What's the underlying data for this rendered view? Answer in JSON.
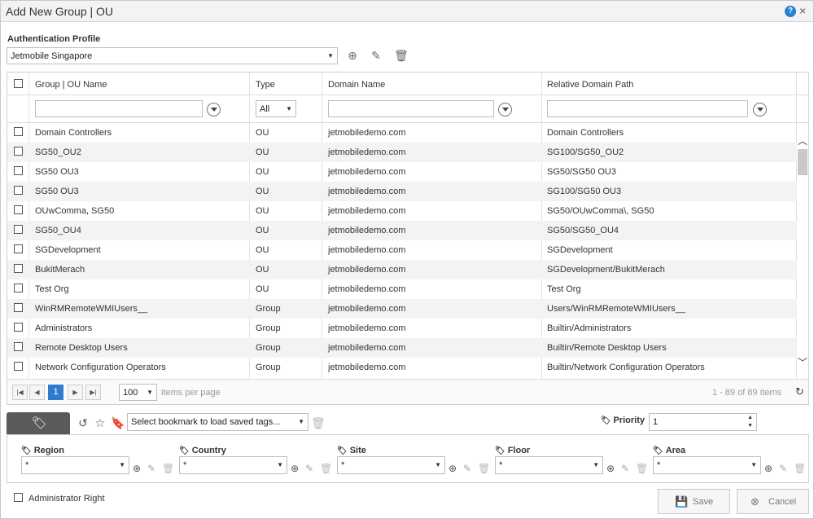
{
  "window": {
    "title": "Add New Group | OU",
    "help_icon": "?",
    "close_icon": "×"
  },
  "auth_profile": {
    "label": "Authentication Profile",
    "value": "Jetmobile Singapore"
  },
  "grid": {
    "headers": {
      "name": "Group | OU Name",
      "type": "Type",
      "domain": "Domain Name",
      "path": "Relative Domain Path"
    },
    "type_filter": "All",
    "rows": [
      {
        "name": "Domain Controllers",
        "type": "OU",
        "domain": "jetmobiledemo.com",
        "path": "Domain Controllers"
      },
      {
        "name": "SG50_OU2",
        "type": "OU",
        "domain": "jetmobiledemo.com",
        "path": "SG100/SG50_OU2"
      },
      {
        "name": "SG50 OU3",
        "type": "OU",
        "domain": "jetmobiledemo.com",
        "path": "SG50/SG50 OU3"
      },
      {
        "name": "SG50 OU3",
        "type": "OU",
        "domain": "jetmobiledemo.com",
        "path": "SG100/SG50 OU3"
      },
      {
        "name": "OUwComma, SG50",
        "type": "OU",
        "domain": "jetmobiledemo.com",
        "path": "SG50/OUwComma\\, SG50"
      },
      {
        "name": "SG50_OU4",
        "type": "OU",
        "domain": "jetmobiledemo.com",
        "path": "SG50/SG50_OU4"
      },
      {
        "name": "SGDevelopment",
        "type": "OU",
        "domain": "jetmobiledemo.com",
        "path": "SGDevelopment"
      },
      {
        "name": "BukitMerach",
        "type": "OU",
        "domain": "jetmobiledemo.com",
        "path": "SGDevelopment/BukitMerach"
      },
      {
        "name": "Test Org",
        "type": "OU",
        "domain": "jetmobiledemo.com",
        "path": "Test Org"
      },
      {
        "name": "WinRMRemoteWMIUsers__",
        "type": "Group",
        "domain": "jetmobiledemo.com",
        "path": "Users/WinRMRemoteWMIUsers__"
      },
      {
        "name": "Administrators",
        "type": "Group",
        "domain": "jetmobiledemo.com",
        "path": "Builtin/Administrators"
      },
      {
        "name": "Remote Desktop Users",
        "type": "Group",
        "domain": "jetmobiledemo.com",
        "path": "Builtin/Remote Desktop Users"
      },
      {
        "name": "Network Configuration Operators",
        "type": "Group",
        "domain": "jetmobiledemo.com",
        "path": "Builtin/Network Configuration Operators"
      }
    ]
  },
  "pager": {
    "first": "|◀",
    "prev": "◀",
    "current_page": "1",
    "next": "▶",
    "last": "▶|",
    "page_size": "100",
    "items_per_page_label": "items per page",
    "count_text": "1 - 89 of 89 items"
  },
  "bookmark": {
    "placeholder": "Select bookmark to load saved tags...",
    "priority_label": "Priority",
    "priority_value": "1"
  },
  "tags": [
    {
      "label": "Region",
      "value": "*"
    },
    {
      "label": "Country",
      "value": "*"
    },
    {
      "label": "Site",
      "value": "*"
    },
    {
      "label": "Floor",
      "value": "*"
    },
    {
      "label": "Area",
      "value": "*"
    }
  ],
  "footer": {
    "admin_right_label": "Administrator Right",
    "save_label": "Save",
    "cancel_label": "Cancel"
  },
  "colors": {
    "accent": "#2e7bcf",
    "tag_tab": "#5a5a5a"
  }
}
